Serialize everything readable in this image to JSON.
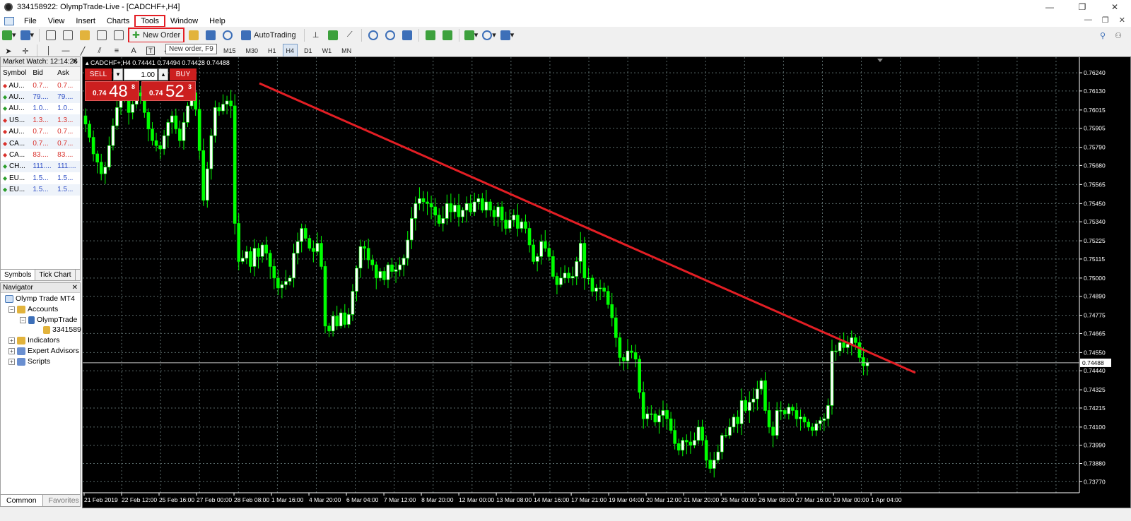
{
  "window": {
    "title": "334158922: OlympTrade-Live - [CADCHF+,H4]",
    "controls": [
      "—",
      "❐",
      "✕"
    ]
  },
  "menu": {
    "items": [
      "File",
      "View",
      "Insert",
      "Charts",
      "Tools",
      "Window",
      "Help"
    ],
    "highlighted": "Tools",
    "mdi_controls": [
      "—",
      "❐",
      "✕"
    ]
  },
  "toolbar": {
    "new_order_label": "New Order",
    "autotrading_label": "AutoTrading",
    "tooltip": "New order, F9",
    "timeframes": [
      "M1",
      "M5",
      "M15",
      "M30",
      "H1",
      "H4",
      "D1",
      "W1",
      "MN"
    ],
    "active_timeframe": "H4",
    "text_tool": "A",
    "text_label_tool": "T"
  },
  "market_watch": {
    "title": "Market Watch: 12:14:26",
    "columns": [
      "Symbol",
      "Bid",
      "Ask"
    ],
    "rows": [
      {
        "symbol": "AU...",
        "bid": "0.7...",
        "ask": "0.7...",
        "dir": "down",
        "color": "red"
      },
      {
        "symbol": "AU...",
        "bid": "79....",
        "ask": "79....",
        "dir": "up",
        "color": "blue"
      },
      {
        "symbol": "AU...",
        "bid": "1.0...",
        "ask": "1.0...",
        "dir": "up",
        "color": "blue"
      },
      {
        "symbol": "US...",
        "bid": "1.3...",
        "ask": "1.3...",
        "dir": "down",
        "color": "red"
      },
      {
        "symbol": "AU...",
        "bid": "0.7...",
        "ask": "0.7...",
        "dir": "down",
        "color": "red"
      },
      {
        "symbol": "CA...",
        "bid": "0.7...",
        "ask": "0.7...",
        "dir": "down",
        "color": "red"
      },
      {
        "symbol": "CA...",
        "bid": "83....",
        "ask": "83....",
        "dir": "down",
        "color": "red"
      },
      {
        "symbol": "CH...",
        "bid": "111....",
        "ask": "111....",
        "dir": "up",
        "color": "blue"
      },
      {
        "symbol": "EU...",
        "bid": "1.5...",
        "ask": "1.5...",
        "dir": "up",
        "color": "blue"
      },
      {
        "symbol": "EU...",
        "bid": "1.5...",
        "ask": "1.5...",
        "dir": "up",
        "color": "blue"
      }
    ],
    "tabs": [
      "Symbols",
      "Tick Chart"
    ]
  },
  "navigator": {
    "title": "Navigator",
    "root": "Olymp Trade MT4",
    "accounts": "Accounts",
    "server": "OlympTrade",
    "account": "3341589",
    "indicators": "Indicators",
    "experts": "Expert Advisors",
    "scripts": "Scripts",
    "tabs": [
      "Common",
      "Favorites"
    ]
  },
  "chart": {
    "header": "CADCHF+,H4  0.74441 0.74494 0.74428 0.74488",
    "one_click": {
      "sell_label": "SELL",
      "buy_label": "BUY",
      "lots": "1.00",
      "minus": "▾",
      "plus": "▴",
      "sell_small": "0.74",
      "sell_big": "48",
      "sell_sup": "8",
      "buy_small": "0.74",
      "buy_big": "52",
      "buy_sup": "3"
    },
    "colors": {
      "background": "#000000",
      "bull": "#ffffff",
      "bear": "#00ff00",
      "grid": "#5a6a6a",
      "trendline": "#e31e24",
      "current_price_line": "#c0c0c0"
    }
  },
  "chart_data": {
    "type": "candlestick",
    "symbol": "CADCHF+",
    "timeframe": "H4",
    "ylim": [
      0.7375,
      0.763
    ],
    "price_labels": [
      "0.76240",
      "0.76130",
      "0.76015",
      "0.75905",
      "0.75790",
      "0.75680",
      "0.75565",
      "0.75450",
      "0.75340",
      "0.75225",
      "0.75115",
      "0.75000",
      "0.74890",
      "0.74775",
      "0.74665",
      "0.74550",
      "0.74440",
      "0.74325",
      "0.74215",
      "0.74100",
      "0.73990",
      "0.73880",
      "0.73770"
    ],
    "current_price": "0.74488",
    "time_labels": [
      "21 Feb 2019",
      "22 Feb 12:00",
      "25 Feb 16:00",
      "27 Feb 00:00",
      "28 Feb 08:00",
      "1 Mar 16:00",
      "4 Mar 20:00",
      "6 Mar 04:00",
      "7 Mar 12:00",
      "8 Mar 20:00",
      "12 Mar 00:00",
      "13 Mar 08:00",
      "14 Mar 16:00",
      "17 Mar 21:00",
      "19 Mar 04:00",
      "20 Mar 12:00",
      "21 Mar 20:00",
      "25 Mar 00:00",
      "26 Mar 08:00",
      "27 Mar 16:00",
      "29 Mar 00:00",
      "1 Apr 04:00"
    ],
    "close": [
      0.7593,
      0.7585,
      0.7575,
      0.757,
      0.7563,
      0.7567,
      0.758,
      0.7592,
      0.7603,
      0.7612,
      0.7608,
      0.76,
      0.7605,
      0.7612,
      0.761,
      0.76,
      0.759,
      0.7583,
      0.758,
      0.7578,
      0.7586,
      0.7594,
      0.7598,
      0.759,
      0.7583,
      0.7594,
      0.7604,
      0.7612,
      0.7602,
      0.7577,
      0.7547,
      0.7566,
      0.7586,
      0.7603,
      0.7601,
      0.7605,
      0.7607,
      0.7604,
      0.7533,
      0.751,
      0.7512,
      0.7516,
      0.7507,
      0.7518,
      0.7513,
      0.752,
      0.7515,
      0.7507,
      0.75,
      0.7494,
      0.7496,
      0.7498,
      0.75,
      0.7515,
      0.7522,
      0.753,
      0.7524,
      0.7518,
      0.7516,
      0.7521,
      0.7507,
      0.7471,
      0.7468,
      0.7477,
      0.7471,
      0.7479,
      0.7472,
      0.7478,
      0.7492,
      0.7506,
      0.7519,
      0.7518,
      0.7511,
      0.7508,
      0.75,
      0.7504,
      0.7499,
      0.7508,
      0.7504,
      0.7505,
      0.7508,
      0.7512,
      0.7523,
      0.7536,
      0.7545,
      0.7548,
      0.7546,
      0.7545,
      0.7543,
      0.7538,
      0.7533,
      0.7536,
      0.7545,
      0.754,
      0.7544,
      0.7537,
      0.7541,
      0.7545,
      0.754,
      0.7546,
      0.7548,
      0.7541,
      0.7546,
      0.7541,
      0.7537,
      0.7543,
      0.7535,
      0.753,
      0.7535,
      0.7538,
      0.753,
      0.7534,
      0.753,
      0.752,
      0.751,
      0.7513,
      0.7522,
      0.7518,
      0.7513,
      0.7501,
      0.7496,
      0.75,
      0.7503,
      0.75,
      0.7501,
      0.751,
      0.7521,
      0.75,
      0.75,
      0.7492,
      0.7494,
      0.7494,
      0.7492,
      0.7484,
      0.7476,
      0.7464,
      0.7452,
      0.745,
      0.7456,
      0.7455,
      0.7451,
      0.7431,
      0.7415,
      0.7418,
      0.7418,
      0.7413,
      0.7417,
      0.742,
      0.7415,
      0.7408,
      0.74,
      0.7396,
      0.7402,
      0.7401,
      0.7399,
      0.7402,
      0.741,
      0.7402,
      0.739,
      0.7385,
      0.739,
      0.7395,
      0.7405,
      0.7405,
      0.741,
      0.7416,
      0.7412,
      0.7426,
      0.742,
      0.7425,
      0.7427,
      0.7433,
      0.7438,
      0.742,
      0.741,
      0.7405,
      0.742,
      0.742,
      0.7418,
      0.7422,
      0.742,
      0.7415,
      0.7416,
      0.7413,
      0.741,
      0.7408,
      0.7412,
      0.7414,
      0.7415,
      0.7423,
      0.7456,
      0.7456,
      0.7461,
      0.7458,
      0.746,
      0.7464,
      0.7461,
      0.7452,
      0.7447,
      0.7449
    ]
  }
}
